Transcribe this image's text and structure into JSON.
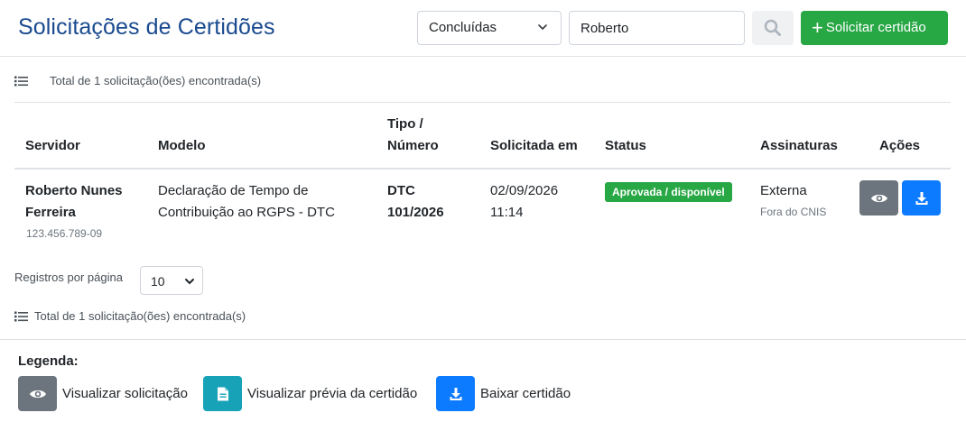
{
  "header": {
    "title": "Solicitações de Certidões",
    "status_filter": "Concluídas",
    "search_value": "Roberto",
    "request_button": "Solicitar certidão",
    "plus_glyph": "+"
  },
  "summary": {
    "total_top": "Total de 1 solicitação(ões) encontrada(s)",
    "total_bottom": "Total de 1 solicitação(ões) encontrada(s)"
  },
  "table": {
    "headers": {
      "servidor": "Servidor",
      "modelo": "Modelo",
      "tipo_line1": "Tipo /",
      "tipo_line2": "Número",
      "solicitada": "Solicitada em",
      "status": "Status",
      "assinaturas": "Assinaturas",
      "acoes": "Ações"
    },
    "rows": [
      {
        "servidor_line1": "Roberto Nunes",
        "servidor_line2": "Ferreira",
        "cpf": "123.456.789-09",
        "modelo_line1": "Declaração de Tempo de",
        "modelo_line2": "Contribuição ao RGPS - DTC",
        "tipo": "DTC",
        "numero": "101/2026",
        "data": "02/09/2026",
        "hora": "11:14",
        "status": "Aprovada / disponível",
        "assinatura": "Externa",
        "assinatura_sub": "Fora do CNIS",
        "actions": [
          "eye-icon",
          "download-icon"
        ]
      }
    ]
  },
  "pagination": {
    "label": "Registros por página",
    "value": "10"
  },
  "legend": {
    "title": "Legenda:",
    "items": [
      {
        "icon": "eye-icon",
        "label": "Visualizar solicitação",
        "color": "#6c757d"
      },
      {
        "icon": "document-icon",
        "label": "Visualizar prévia da certidão",
        "color": "#17a2b8"
      },
      {
        "icon": "download-icon",
        "label": "Baixar certidão",
        "color": "#0d7bff"
      }
    ]
  },
  "colors": {
    "title": "#1a4a8f",
    "success": "#28a745",
    "primary": "#0d7bff",
    "secondary": "#6c757d",
    "info": "#17a2b8"
  }
}
